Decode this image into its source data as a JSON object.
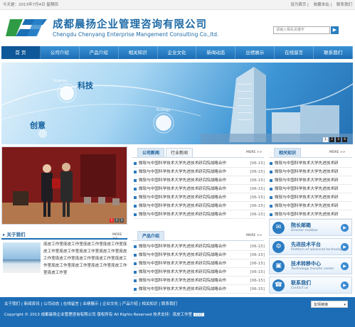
{
  "topbar": {
    "date": "今天是：2013年7月4日 星期四",
    "links": [
      "设为首页",
      "收藏本站",
      "联系我们"
    ]
  },
  "brand": {
    "name_cn": "成都晨扬企业管理咨询有限公司",
    "name_en": "Chengdu Chenyang Enterprise Mangement Consulting Co.,ltd.",
    "search_placeholder": "请输入相关关键字",
    "search_button": "▶"
  },
  "nav": [
    "首 页",
    "公司介绍",
    "产品介绍",
    "相关知识",
    "企业文化",
    "新闻动态",
    "业绩展示",
    "在线留言",
    "联系我们"
  ],
  "banner": {
    "science": "Science",
    "keji": "科技",
    "ecology": "Ecology",
    "chuangyi": "创意",
    "dots": [
      "1",
      "2",
      "3",
      "4"
    ]
  },
  "photo": {
    "pager": [
      "1",
      "2",
      "3"
    ]
  },
  "news": {
    "tabs": [
      "公司新闻",
      "行业新闻"
    ],
    "more": "MORE >>",
    "items": [
      {
        "title": "微软与中国科学技术大学先进技术研究院战略合作",
        "date": "[06-15]"
      },
      {
        "title": "微软与中国科学技术大学先进技术研究院战略合作",
        "date": "[06-15]"
      },
      {
        "title": "微软与中国科学技术大学先进技术研究院战略合作",
        "date": "[06-15]"
      },
      {
        "title": "微软与中国科学技术大学先进技术研究院战略合作",
        "date": "[06-15]"
      },
      {
        "title": "微软与中国科学技术大学先进技术研究院战略合作",
        "date": "[06-15]"
      },
      {
        "title": "微软与中国科学技术大学先进技术研究院战略合作",
        "date": "[06-15]"
      },
      {
        "title": "微软与中国科学技术大学先进技术研究院战略合作",
        "date": "[06-15]"
      }
    ]
  },
  "knowledge": {
    "title": "相关知识",
    "more": "MORE >>",
    "items": [
      "微软与中国科学技术大学先进技术研",
      "微软与中国科学技术大学先进技术研",
      "微软与中国科学技术大学先进技术研",
      "微软与中国科学技术大学先进技术研",
      "微软与中国科学技术大学先进技术研",
      "微软与中国科学技术大学先进技术研",
      "微软与中国科学技术大学先进技术研"
    ]
  },
  "about": {
    "title": "关于我们",
    "more": "MORE >>",
    "text": "庞皮工作室庞皮工作室庞皮工作室庞皮工作室庞皮工作室庞皮工作室庞皮工作室庞皮工作室庞皮工作室庞皮工作室庞皮工作室庞皮工作室庞皮工作室庞皮工作室庞皮工作室庞皮工作室庞皮工作室庞皮工作室"
  },
  "products": {
    "title": "产品介绍",
    "more": "MORE >>",
    "items": [
      {
        "title": "微软与中国科学技术大学先进技术研究院战略合作",
        "date": "[06-15]"
      },
      {
        "title": "微软与中国科学技术大学先进技术研究院战略合作",
        "date": "[06-15]"
      },
      {
        "title": "微软与中国科学技术大学先进技术研究院战略合作",
        "date": "[06-15]"
      },
      {
        "title": "微软与中国科学技术大学先进技术研究院战略合作",
        "date": "[06-15]"
      },
      {
        "title": "微软与中国科学技术大学先进技术研究院战略合作",
        "date": "[06-15]"
      },
      {
        "title": "微软与中国科学技术大学先进技术研究院战略合作",
        "date": "[06-15]"
      }
    ]
  },
  "services": [
    {
      "cn": "院长邮箱",
      "en": "Director mailbox",
      "icon": "✉"
    },
    {
      "cn": "先进技术平台",
      "en": "Platform of advanced technology",
      "icon": "⚙"
    },
    {
      "cn": "技术转移中心",
      "en": "Technology transfer center",
      "icon": "▣"
    },
    {
      "cn": "联系我们",
      "en": "Contact us",
      "icon": "☎"
    }
  ],
  "footer": {
    "links": [
      "关于我们",
      "新闻资讯",
      "公司动态",
      "在线留言",
      "业绩展示",
      "企业文化",
      "产品介绍",
      "相关知识",
      "联系我们"
    ],
    "copyright": "Copyright © 2013 成都晨扬企业管理咨询有限公司 版权所有 All Rights Reserved 技术支持：庞皮工作室",
    "friend_links": "友情链接",
    "badge": "ZZZZ"
  }
}
